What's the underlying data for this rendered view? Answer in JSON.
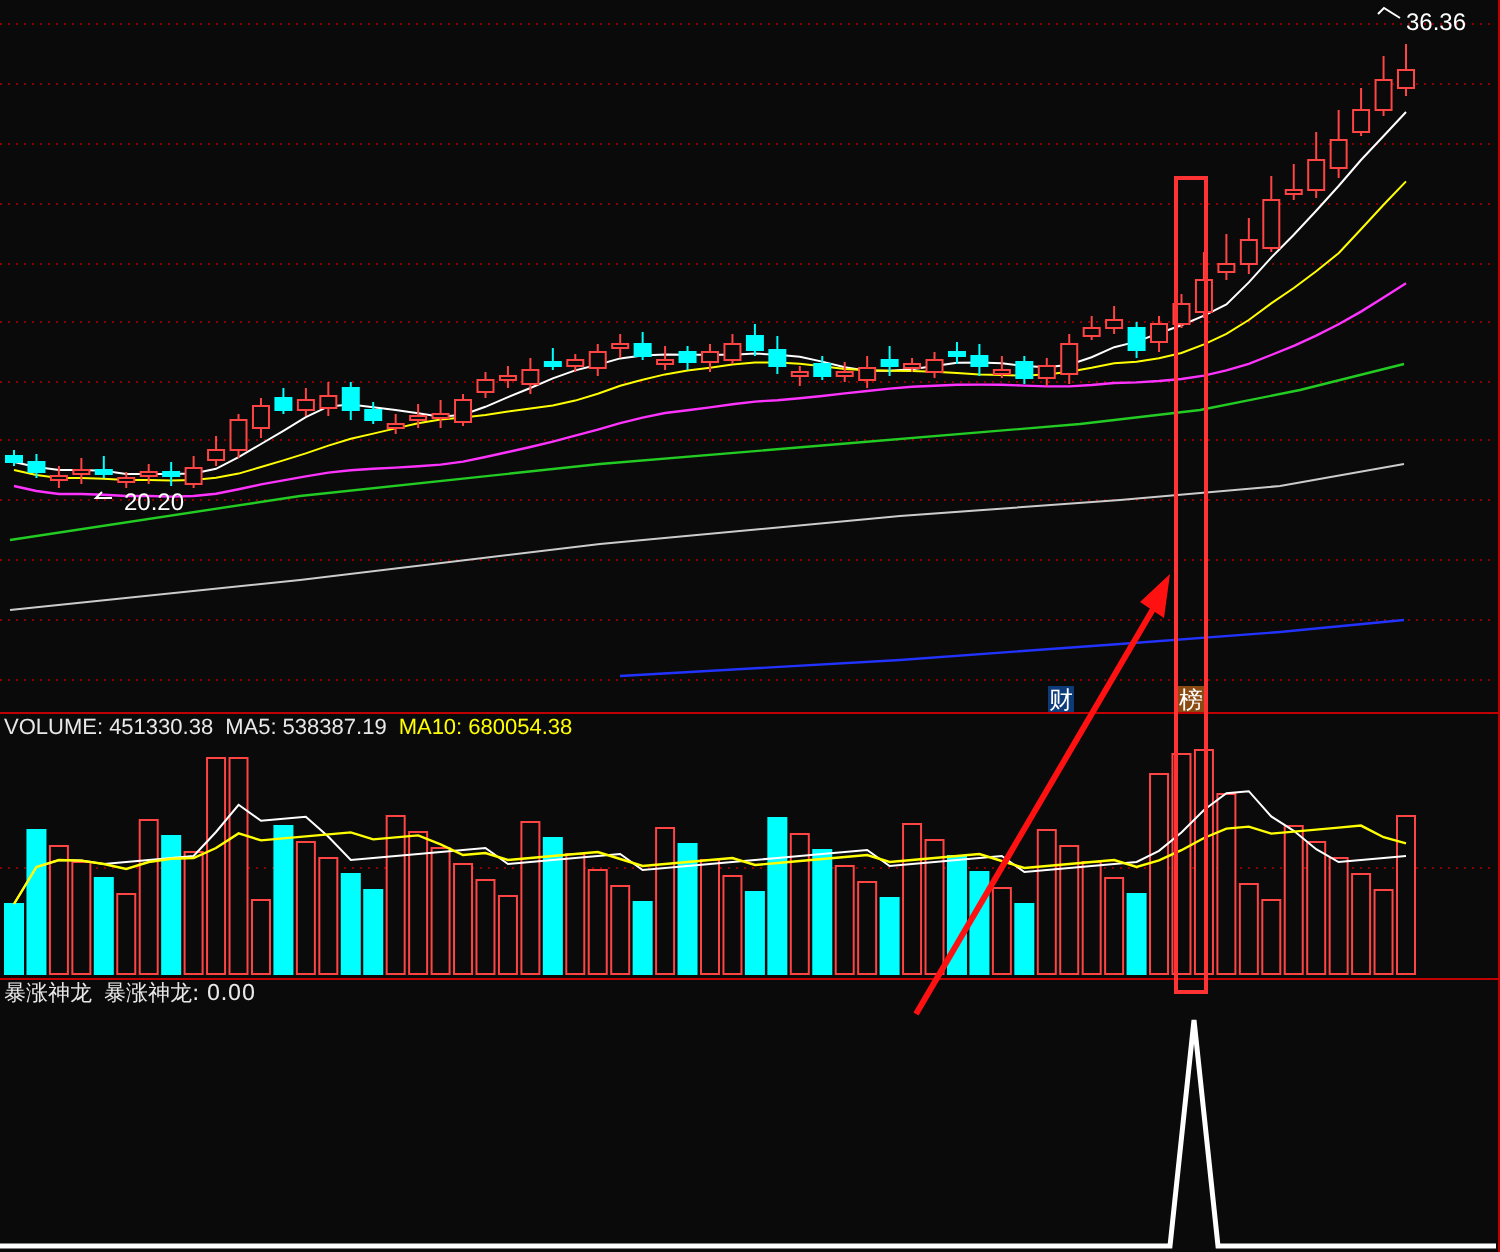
{
  "main_chart": {
    "high_label": "36.36",
    "low_label": "20.20",
    "markers": [
      {
        "text": "财",
        "color": "#0d3a78"
      },
      {
        "text": "榜",
        "color": "#8a4a12"
      }
    ]
  },
  "volume_panel": {
    "volume": "VOLUME: 451330.38",
    "ma5": "MA5: 538387.19",
    "ma10": "MA10: 680054.38"
  },
  "indicator_panel": {
    "name": "暴涨神龙",
    "reading": "暴涨神龙: 0.00"
  }
}
